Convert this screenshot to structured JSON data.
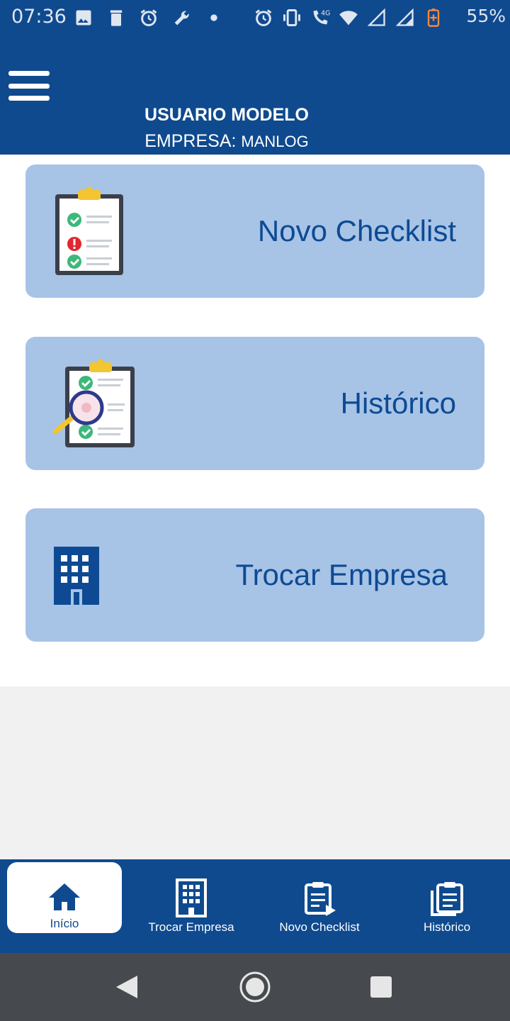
{
  "status_bar": {
    "time": "07:36",
    "battery": "55%",
    "left_icons": [
      "image-icon",
      "trash-icon",
      "alarm-icon",
      "wrench-icon",
      "dot-icon"
    ],
    "right_icons": [
      "alarm-icon",
      "vibrate-icon",
      "wifi-call-icon",
      "wifi-icon",
      "signal-icon",
      "signal-icon",
      "battery-charging-icon"
    ],
    "network_badge": "4G"
  },
  "header": {
    "user_name": "USUARIO MODELO",
    "company_label": "EMPRESA:",
    "company_value": "MANLOG"
  },
  "cards": [
    {
      "label": "Novo Checklist",
      "icon": "checklist-icon"
    },
    {
      "label": "Histórico",
      "icon": "checklist-search-icon"
    },
    {
      "label": "Trocar Empresa",
      "icon": "building-icon"
    }
  ],
  "bottom_nav": {
    "items": [
      {
        "label": "Início",
        "icon": "home-icon",
        "active": true
      },
      {
        "label": "Trocar Empresa",
        "icon": "building-outline-icon",
        "active": false
      },
      {
        "label": "Novo Checklist",
        "icon": "clipboard-play-icon",
        "active": false
      },
      {
        "label": "Histórico",
        "icon": "clipboard-stack-icon",
        "active": false
      }
    ]
  },
  "colors": {
    "primary": "#0f4a8f",
    "card_background": "#a7c3e6",
    "card_text": "#0d4a93",
    "system_nav": "#464a4f"
  }
}
